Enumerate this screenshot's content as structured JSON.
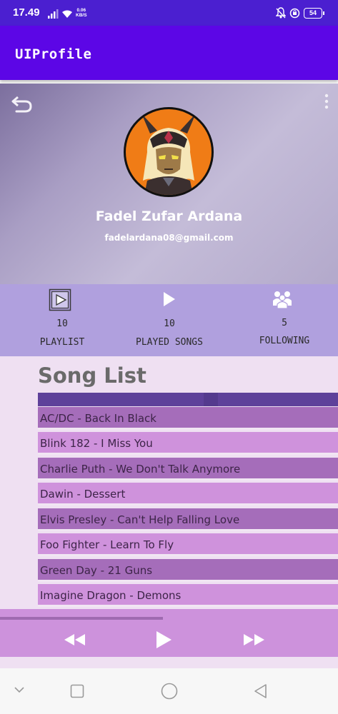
{
  "status_bar": {
    "time": "17.49",
    "speed_value": "0.06",
    "speed_unit": "KB/S",
    "battery": "54"
  },
  "app_bar": {
    "title": "UIProfile"
  },
  "profile": {
    "name": "Fadel Zufar Ardana",
    "email": "fadelardana08@gmail.com",
    "avatar_icon": "avatar-icon"
  },
  "stats": [
    {
      "count": "10",
      "label": "PLAYLIST",
      "icon": "playlist-icon"
    },
    {
      "count": "10",
      "label": "PLAYED SONGS",
      "icon": "play-icon"
    },
    {
      "count": "5",
      "label": "FOLLOWING",
      "icon": "people-icon"
    }
  ],
  "song_list": {
    "title": "Song List",
    "songs": [
      "AC/DC - Back In Black",
      "Blink 182 - I Miss You",
      "Charlie Puth - We Don't Talk Anymore",
      "Dawin - Dessert",
      "Elvis Presley - Can't Help Falling Love",
      "Foo Fighter - Learn To Fly",
      "Green Day - 21 Guns",
      "Imagine Dragon - Demons"
    ]
  },
  "player": {
    "controls": [
      "rewind-icon",
      "play-icon",
      "fast-forward-icon"
    ]
  },
  "colors": {
    "status_bar": "#4b1fd0",
    "app_bar": "#5c06e6",
    "stats_bar": "#b0a0de",
    "row_dark": "#a56dba",
    "row_light": "#cf92dc",
    "avatar_bg": "#f07c16"
  }
}
